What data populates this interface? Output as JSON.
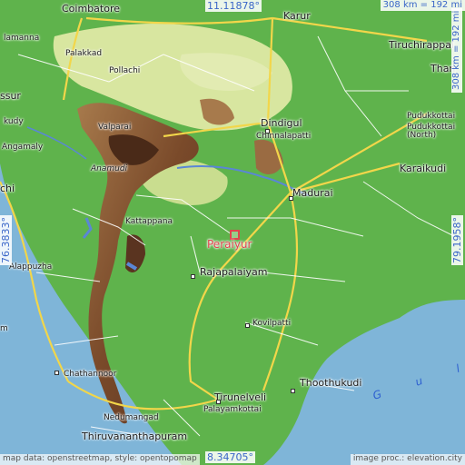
{
  "map": {
    "colors": {
      "sea": "#7fb5d8",
      "lowland": "#5fb34c",
      "plain": "#d8e6a0",
      "highland": "#8a5a34",
      "peak": "#4a2a18",
      "road_major": "#f2d64a",
      "road_minor": "#ffffff",
      "river": "#5a86d6",
      "target": "#e0444c",
      "coord_text": "#3a66c8"
    },
    "target": {
      "name": "Peraiyur",
      "icon": "target-square-icon"
    },
    "places": [
      {
        "id": "coimbatore",
        "name": "Coimbatore"
      },
      {
        "id": "karur",
        "name": "Karur"
      },
      {
        "id": "tiruchirappalli",
        "name": "Tiruchirappal"
      },
      {
        "id": "thanjavur",
        "name": "Than"
      },
      {
        "id": "palakkad",
        "name": "Palakkad"
      },
      {
        "id": "pollachi",
        "name": "Pollachi"
      },
      {
        "id": "annamalai",
        "name": "lamanna"
      },
      {
        "id": "thrissur",
        "name": "ssur"
      },
      {
        "id": "chalakudy",
        "name": "kudy"
      },
      {
        "id": "valparai",
        "name": "Valparai"
      },
      {
        "id": "dindigul",
        "name": "Dindigul"
      },
      {
        "id": "chinnalapatti",
        "name": "Chinnalapatti"
      },
      {
        "id": "pudukkottai",
        "name": "Pudukkottai"
      },
      {
        "id": "pudukkottai_north",
        "name": "Pudukkottai\n(North)"
      },
      {
        "id": "angamaly",
        "name": "Angamaly"
      },
      {
        "id": "anamudi",
        "name": "Anamudi"
      },
      {
        "id": "karaikudi",
        "name": "Karaikudi"
      },
      {
        "id": "kochi",
        "name": "chi"
      },
      {
        "id": "madurai",
        "name": "Madurai"
      },
      {
        "id": "kattappana",
        "name": "Kattappana"
      },
      {
        "id": "alappuzha",
        "name": "Alappuzha"
      },
      {
        "id": "rajapalaiyam",
        "name": "Rajapalaiyam"
      },
      {
        "id": "kovilpatti",
        "name": "Kovilpatti"
      },
      {
        "id": "kayamkulam",
        "name": "m"
      },
      {
        "id": "chathannoor",
        "name": "Chathannoor"
      },
      {
        "id": "thoothukudi",
        "name": "Thoothukudi"
      },
      {
        "id": "tirunelveli",
        "name": "Tirunelveli"
      },
      {
        "id": "palayamkottai",
        "name": "Palayamkottai"
      },
      {
        "id": "nedumangad",
        "name": "Nedumangad"
      },
      {
        "id": "thiruvananthapuram",
        "name": "Thiruvananthapuram"
      }
    ],
    "water_label": "G u l",
    "coords": {
      "top": "11.11878°",
      "bottom": "8.34705°",
      "left": "76.3833°",
      "right": "79.1958°"
    },
    "scale": "308 km = 192 mi",
    "attribution_left": "map data: openstreetmap, style: opentopomap",
    "attribution_right": "image proc.: elevation.city"
  }
}
